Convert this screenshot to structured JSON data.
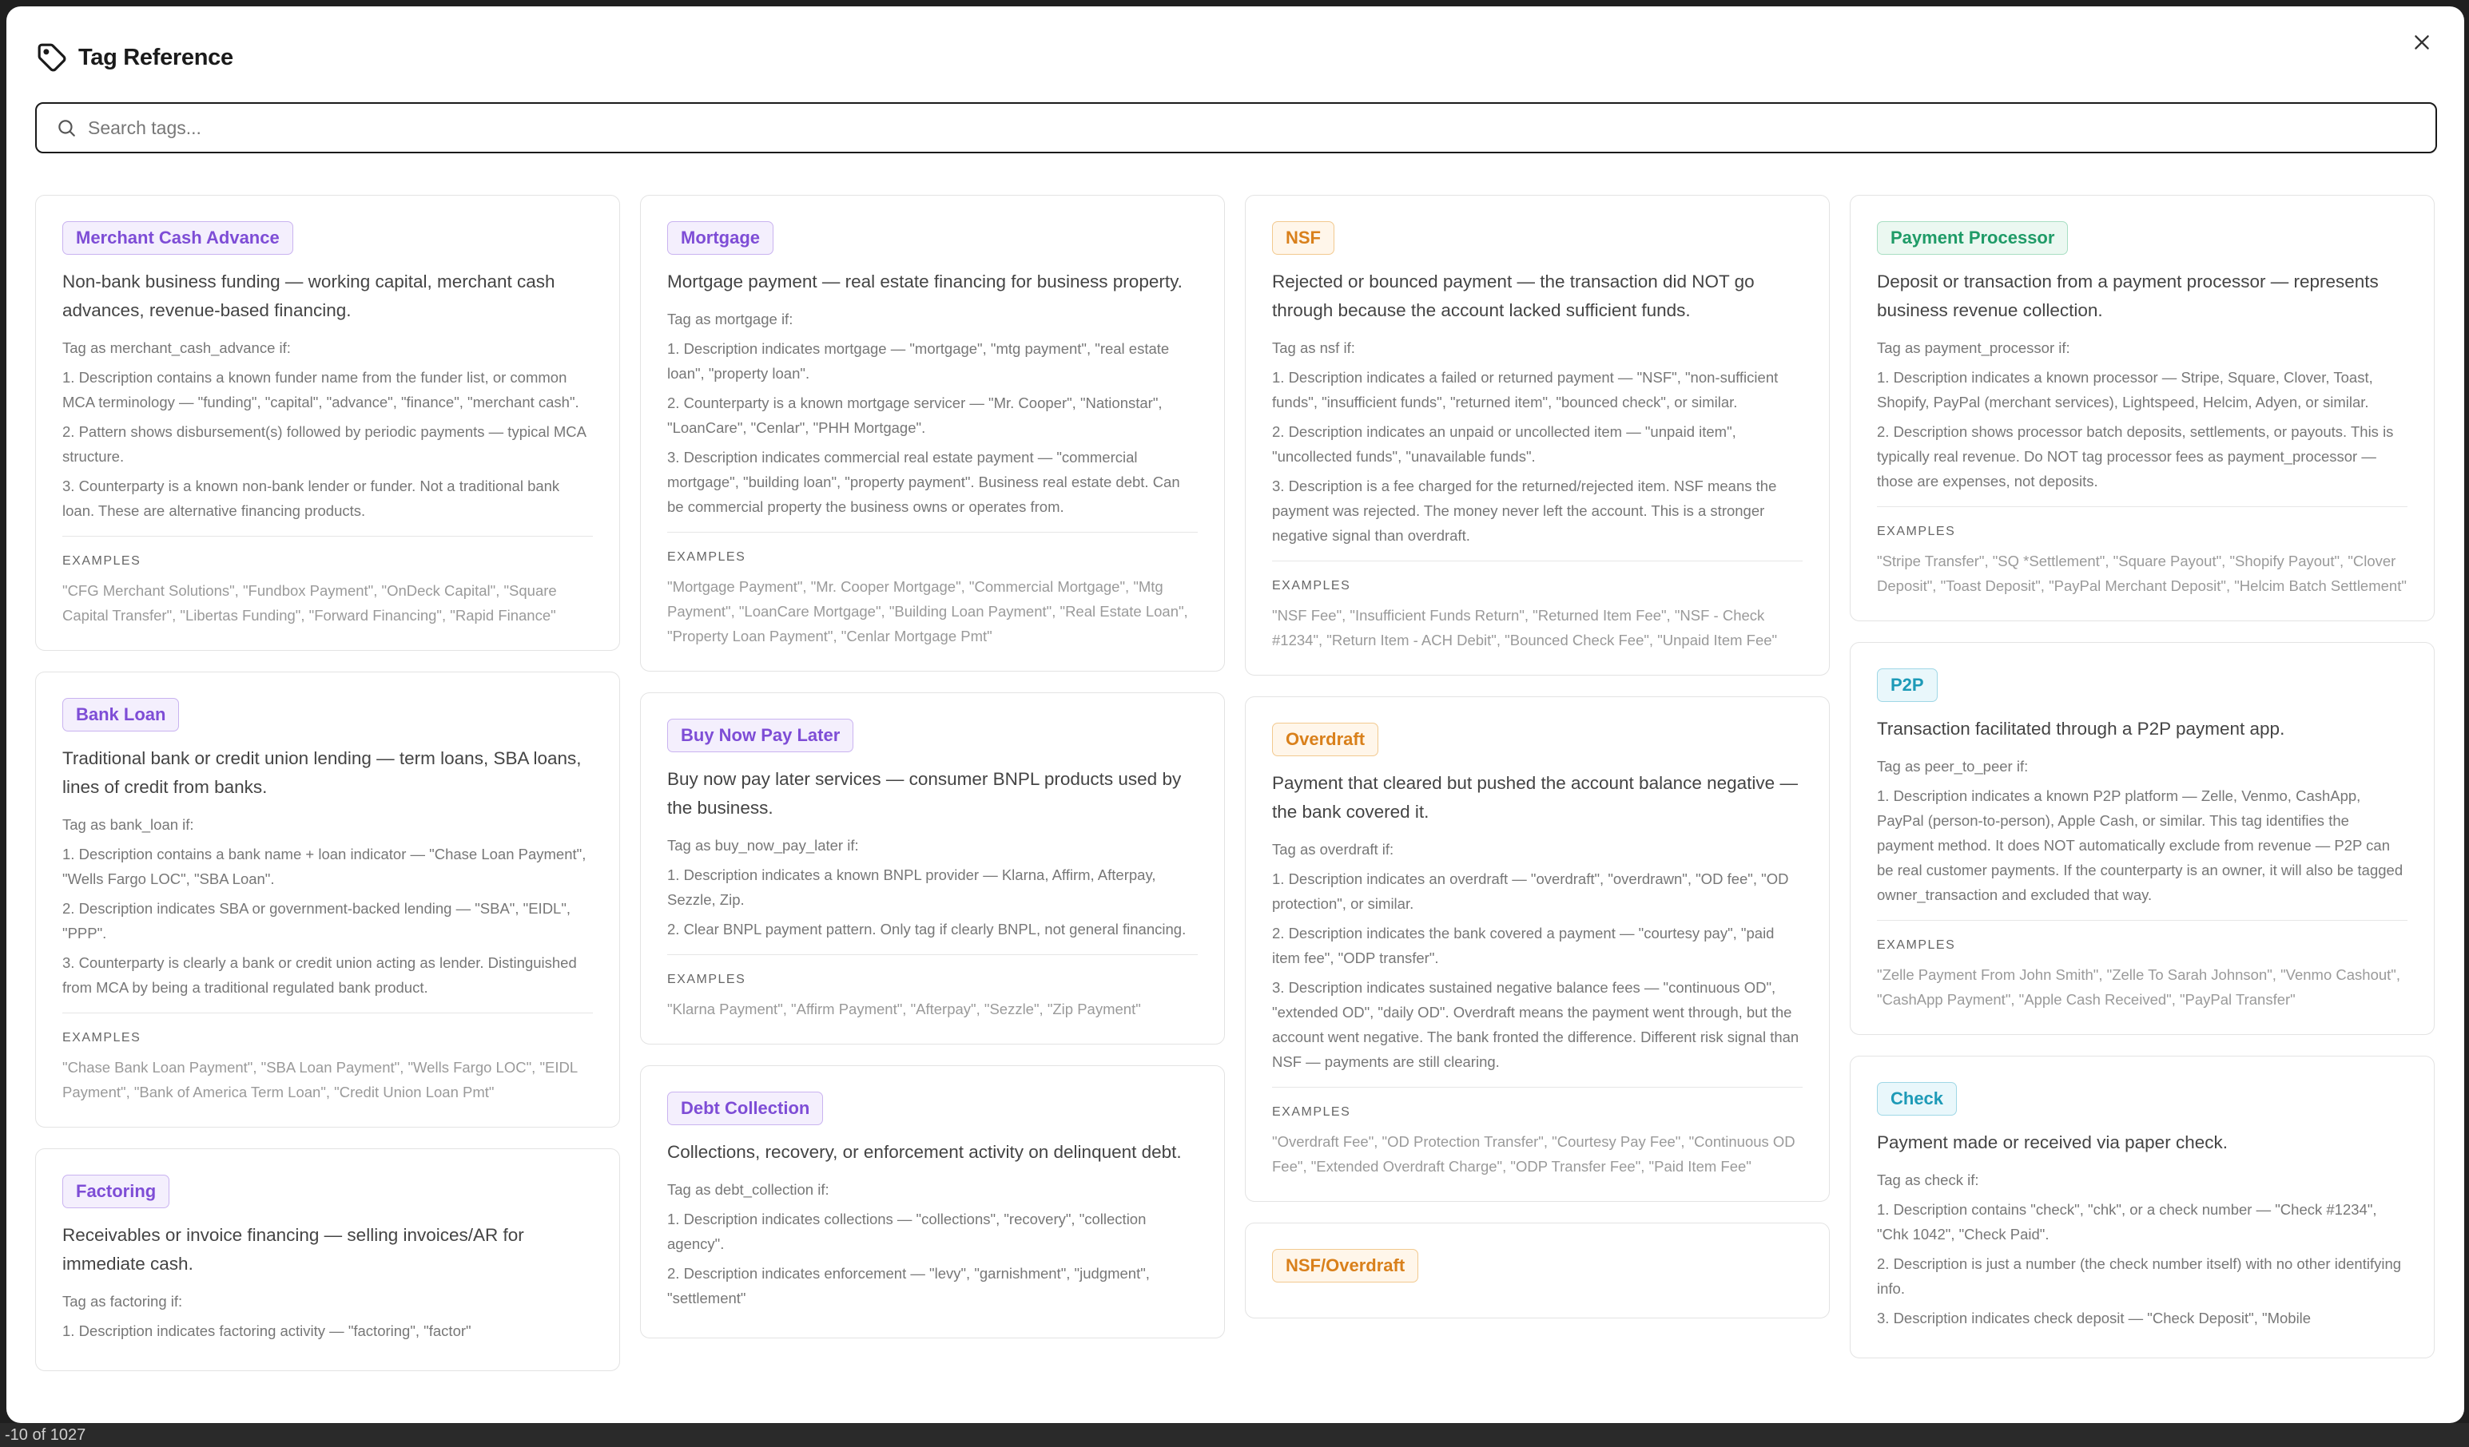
{
  "modal": {
    "title": "Tag Reference",
    "close_label": "×",
    "search_placeholder": "Search tags..."
  },
  "background": {
    "pagination_text": "-10 of 1027"
  },
  "examples_label": "EXAMPLES",
  "colors": {
    "purple": "#7e4dd6",
    "orange": "#d9801b",
    "green": "#1f9b67",
    "teal": "#1d9ab7"
  },
  "cards": {
    "mca": {
      "badge": "Merchant Cash Advance",
      "desc": "Non-bank business funding — working capital, merchant cash advances, revenue-based financing.",
      "rule_title": "Tag as merchant_cash_advance if:",
      "rules": [
        "1. Description contains a known funder name from the funder list, or common MCA terminology — \"funding\", \"capital\", \"advance\", \"finance\", \"merchant cash\".",
        "2. Pattern shows disbursement(s) followed by periodic payments — typical MCA structure.",
        "3. Counterparty is a known non-bank lender or funder. Not a traditional bank loan. These are alternative financing products."
      ],
      "examples": "\"CFG Merchant Solutions\", \"Fundbox Payment\", \"OnDeck Capital\", \"Square Capital Transfer\", \"Libertas Funding\", \"Forward Financing\", \"Rapid Finance\""
    },
    "bank_loan": {
      "badge": "Bank Loan",
      "desc": "Traditional bank or credit union lending — term loans, SBA loans, lines of credit from banks.",
      "rule_title": "Tag as bank_loan if:",
      "rules": [
        "1. Description contains a bank name + loan indicator — \"Chase Loan Payment\", \"Wells Fargo LOC\", \"SBA Loan\".",
        "2. Description indicates SBA or government-backed lending — \"SBA\", \"EIDL\", \"PPP\".",
        "3. Counterparty is clearly a bank or credit union acting as lender. Distinguished from MCA by being a traditional regulated bank product."
      ],
      "examples": "\"Chase Bank Loan Payment\", \"SBA Loan Payment\", \"Wells Fargo LOC\", \"EIDL Payment\", \"Bank of America Term Loan\", \"Credit Union Loan Pmt\""
    },
    "factoring": {
      "badge": "Factoring",
      "desc": "Receivables or invoice financing — selling invoices/AR for immediate cash.",
      "rule_title": "Tag as factoring if:",
      "rules": [
        "1. Description indicates factoring activity — \"factoring\", \"factor\""
      ]
    },
    "mortgage": {
      "badge": "Mortgage",
      "desc": "Mortgage payment — real estate financing for business property.",
      "rule_title": "Tag as mortgage if:",
      "rules": [
        "1. Description indicates mortgage — \"mortgage\", \"mtg payment\", \"real estate loan\", \"property loan\".",
        "2. Counterparty is a known mortgage servicer — \"Mr. Cooper\", \"Nationstar\", \"LoanCare\", \"Cenlar\", \"PHH Mortgage\".",
        "3. Description indicates commercial real estate payment — \"commercial mortgage\", \"building loan\", \"property payment\". Business real estate debt. Can be commercial property the business owns or operates from."
      ],
      "examples": "\"Mortgage Payment\", \"Mr. Cooper Mortgage\", \"Commercial Mortgage\", \"Mtg Payment\", \"LoanCare Mortgage\", \"Building Loan Payment\", \"Real Estate Loan\", \"Property Loan Payment\", \"Cenlar Mortgage Pmt\""
    },
    "bnpl": {
      "badge": "Buy Now Pay Later",
      "desc": "Buy now pay later services — consumer BNPL products used by the business.",
      "rule_title": "Tag as buy_now_pay_later if:",
      "rules": [
        "1. Description indicates a known BNPL provider — Klarna, Affirm, Afterpay, Sezzle, Zip.",
        "2. Clear BNPL payment pattern. Only tag if clearly BNPL, not general financing."
      ],
      "examples": "\"Klarna Payment\", \"Affirm Payment\", \"Afterpay\", \"Sezzle\", \"Zip Payment\""
    },
    "debt_collection": {
      "badge": "Debt Collection",
      "desc": "Collections, recovery, or enforcement activity on delinquent debt.",
      "rule_title": "Tag as debt_collection if:",
      "rules": [
        "1. Description indicates collections — \"collections\", \"recovery\", \"collection agency\".",
        "2. Description indicates enforcement — \"levy\", \"garnishment\", \"judgment\", \"settlement\""
      ]
    },
    "nsf": {
      "badge": "NSF",
      "desc": "Rejected or bounced payment — the transaction did NOT go through because the account lacked sufficient funds.",
      "rule_title": "Tag as nsf if:",
      "rules": [
        "1. Description indicates a failed or returned payment — \"NSF\", \"non-sufficient funds\", \"insufficient funds\", \"returned item\", \"bounced check\", or similar.",
        "2. Description indicates an unpaid or uncollected item — \"unpaid item\", \"uncollected funds\", \"unavailable funds\".",
        "3. Description is a fee charged for the returned/rejected item. NSF means the payment was rejected. The money never left the account. This is a stronger negative signal than overdraft."
      ],
      "examples": "\"NSF Fee\", \"Insufficient Funds Return\", \"Returned Item Fee\", \"NSF - Check #1234\", \"Return Item - ACH Debit\", \"Bounced Check Fee\", \"Unpaid Item Fee\""
    },
    "overdraft": {
      "badge": "Overdraft",
      "desc": "Payment that cleared but pushed the account balance negative — the bank covered it.",
      "rule_title": "Tag as overdraft if:",
      "rules": [
        "1. Description indicates an overdraft — \"overdraft\", \"overdrawn\", \"OD fee\", \"OD protection\", or similar.",
        "2. Description indicates the bank covered a payment — \"courtesy pay\", \"paid item fee\", \"ODP transfer\".",
        "3. Description indicates sustained negative balance fees — \"continuous OD\", \"extended OD\", \"daily OD\". Overdraft means the payment went through, but the account went negative. The bank fronted the difference. Different risk signal than NSF — payments are still clearing."
      ],
      "examples": "\"Overdraft Fee\", \"OD Protection Transfer\", \"Courtesy Pay Fee\", \"Continuous OD Fee\", \"Extended Overdraft Charge\", \"ODP Transfer Fee\", \"Paid Item Fee\""
    },
    "nsf_overdraft": {
      "badge": "NSF/Overdraft"
    },
    "payment_processor": {
      "badge": "Payment Processor",
      "desc": "Deposit or transaction from a payment processor — represents business revenue collection.",
      "rule_title": "Tag as payment_processor if:",
      "rules": [
        "1. Description indicates a known processor — Stripe, Square, Clover, Toast, Shopify, PayPal (merchant services), Lightspeed, Helcim, Adyen, or similar.",
        "2. Description shows processor batch deposits, settlements, or payouts. This is typically real revenue. Do NOT tag processor fees as payment_processor — those are expenses, not deposits."
      ],
      "examples": "\"Stripe Transfer\", \"SQ *Settlement\", \"Square Payout\", \"Shopify Payout\", \"Clover Deposit\", \"Toast Deposit\", \"PayPal Merchant Deposit\", \"Helcim Batch Settlement\""
    },
    "p2p": {
      "badge": "P2P",
      "desc": "Transaction facilitated through a P2P payment app.",
      "rule_title": "Tag as peer_to_peer if:",
      "rules": [
        "1. Description indicates a known P2P platform — Zelle, Venmo, CashApp, PayPal (person-to-person), Apple Cash, or similar. This tag identifies the payment method. It does NOT automatically exclude from revenue — P2P can be real customer payments. If the counterparty is an owner, it will also be tagged owner_transaction and excluded that way."
      ],
      "examples": "\"Zelle Payment From John Smith\", \"Zelle To Sarah Johnson\", \"Venmo Cashout\", \"CashApp Payment\", \"Apple Cash Received\", \"PayPal Transfer\""
    },
    "check": {
      "badge": "Check",
      "desc": "Payment made or received via paper check.",
      "rule_title": "Tag as check if:",
      "rules": [
        "1. Description contains \"check\", \"chk\", or a check number — \"Check #1234\", \"Chk 1042\", \"Check Paid\".",
        "2. Description is just a number (the check number itself) with no other identifying info.",
        "3. Description indicates check deposit — \"Check Deposit\", \"Mobile"
      ]
    }
  }
}
